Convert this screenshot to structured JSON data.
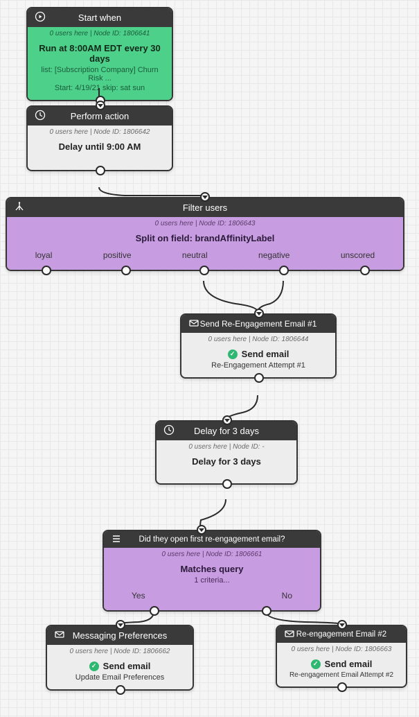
{
  "nodes": {
    "start": {
      "header": "Start when",
      "meta": "0 users here | Node ID: 1806641",
      "title": "Run at 8:00AM EDT every 30 days",
      "sub1": "list: [Subscription Company] Churn Risk ...",
      "sub2": "Start: 4/19/21 skip: sat sun"
    },
    "action": {
      "header": "Perform action",
      "meta": "0 users here | Node ID: 1806642",
      "title": "Delay until 9:00 AM"
    },
    "filter": {
      "header": "Filter users",
      "meta": "0 users here | Node ID: 1806643",
      "title": "Split on field: brandAffinityLabel",
      "options": [
        "loyal",
        "positive",
        "neutral",
        "negative",
        "unscored"
      ]
    },
    "email1": {
      "header": "Send Re-Engagement Email #1",
      "meta": "0 users here | Node ID: 1806644",
      "title": "Send email",
      "sub": "Re-Engagement Attempt #1"
    },
    "delay3": {
      "header": "Delay for 3 days",
      "meta": "0 users here | Node ID: -",
      "title": "Delay for 3 days"
    },
    "query": {
      "header": "Did they open first re-engagement email?",
      "meta": "0 users here | Node ID: 1806661",
      "title": "Matches query",
      "sub": "1 criteria...",
      "yes": "Yes",
      "no": "No"
    },
    "prefs": {
      "header": "Messaging Preferences",
      "meta": "0 users here | Node ID: 1806662",
      "title": "Send email",
      "sub": "Update Email Preferences"
    },
    "email2": {
      "header": "Re-engagement Email #2",
      "meta": "0 users here | Node ID: 1806663",
      "title": "Send email",
      "sub": "Re-engagement Email Attempt #2"
    }
  }
}
